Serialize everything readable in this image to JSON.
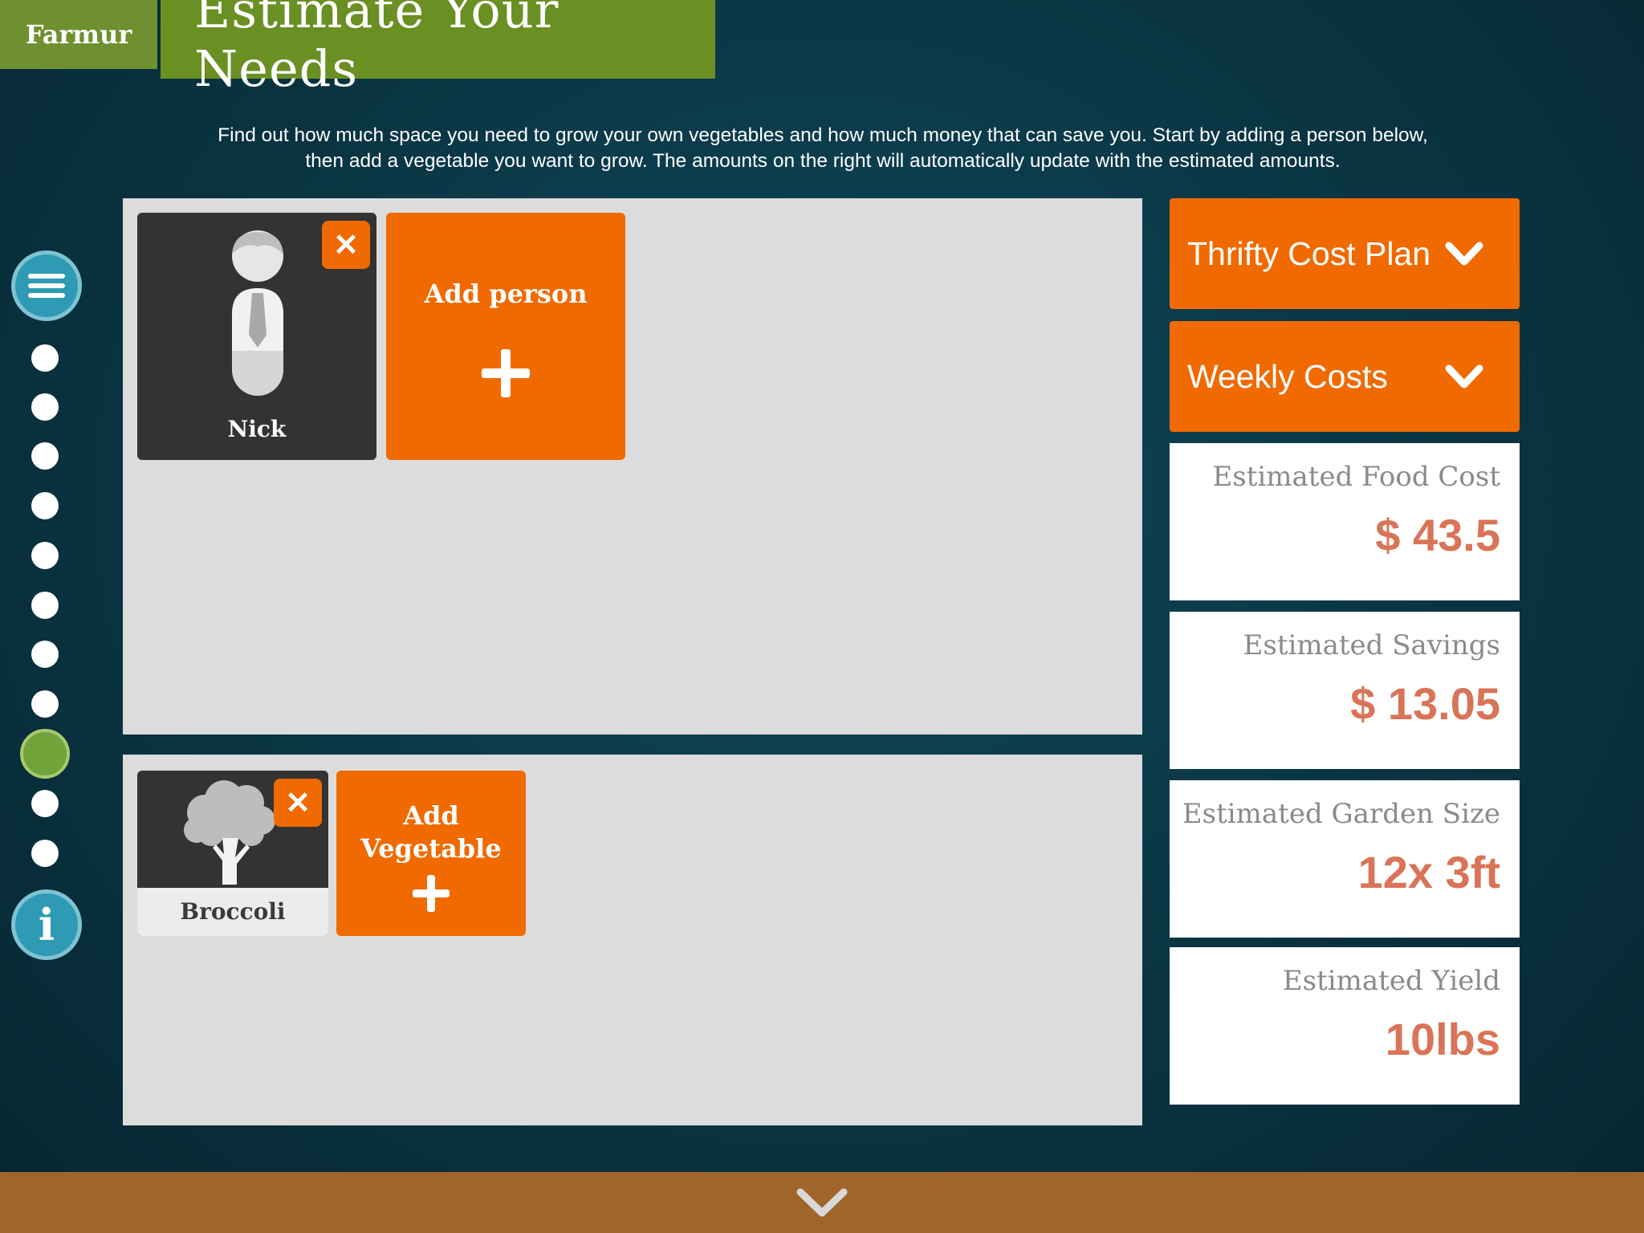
{
  "brand": "Farmur",
  "page_title": "Estimate Your Needs",
  "intro": {
    "line1": "Find out how much space you need to grow your own vegetables and how much money that can save you. Start by adding a person below,",
    "line2": "then add a vegetable you want to grow. The amounts on the right will automatically update with the estimated amounts."
  },
  "nav": {
    "dot_count": 11,
    "active_index": 8,
    "icons": [
      "menu-icon",
      "info-icon"
    ]
  },
  "people": {
    "items": [
      {
        "name": "Nick",
        "icon": "person-icon"
      }
    ],
    "add_label": "Add person"
  },
  "vegetables": {
    "items": [
      {
        "name": "Broccoli",
        "icon": "broccoli-icon"
      }
    ],
    "add_label_line1": "Add",
    "add_label_line2": "Vegetable"
  },
  "dropdowns": {
    "plan": "Thrifty Cost Plan",
    "period": "Weekly Costs"
  },
  "stats": {
    "food_cost_label": "Estimated Food Cost",
    "food_cost_value": "$ 43.5",
    "savings_label": "Estimated Savings",
    "savings_value": "$ 13.05",
    "garden_label": "Estimated Garden Size",
    "garden_value": "12x 3ft",
    "yield_label": "Estimated Yield",
    "yield_value": "10lbs"
  },
  "colors": {
    "background": "#0a3442",
    "brand_green": "#6a8f23",
    "accent_orange": "#f06a00",
    "value_salmon": "#d97458",
    "nav_blue": "#2f9ab3",
    "active_dot": "#72a23a",
    "footer": "#a0652a"
  }
}
